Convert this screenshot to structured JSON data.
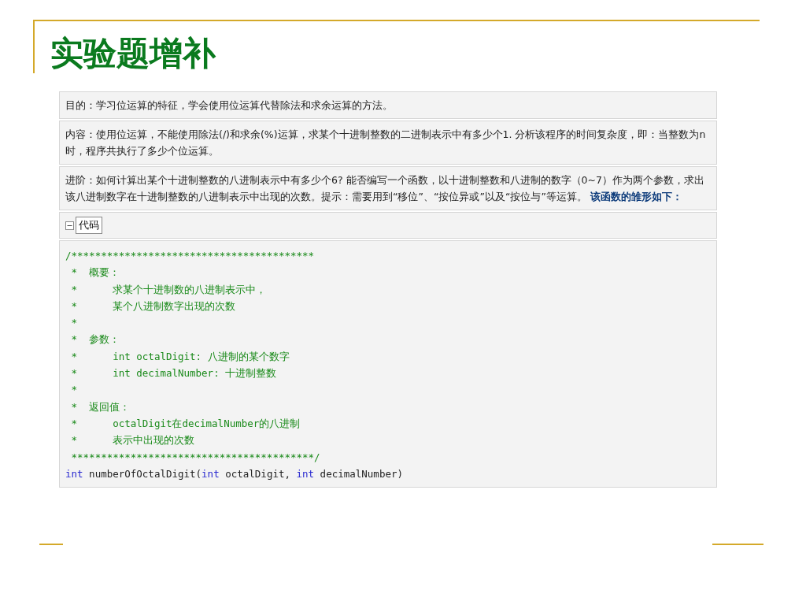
{
  "slide": {
    "title": "实验题增补"
  },
  "panels": [
    {
      "text": "目的：学习位运算的特征，学会使用位运算代替除法和求余运算的方法。"
    },
    {
      "text": "内容：使用位运算，不能使用除法(/)和求余(%)运算，求某个十进制整数的二进制表示中有多少个1. 分析该程序的时间复杂度，即：当整数为n时，程序共执行了多少个位运算。"
    },
    {
      "text": "进阶：如何计算出某个十进制整数的八进制表示中有多少个6? 能否编写一个函数，以十进制整数和八进制的数字（0~7）作为两个参数，求出该八进制数字在十进制整数的八进制表示中出现的次数。提示：需要用到“移位”、“按位异或”以及“按位与”等运算。 **该函数的雏形如下：**"
    }
  ],
  "code_block": {
    "toggle_label": "代码",
    "expanded": true,
    "lines": [
      {
        "kind": "comment",
        "text": "/*****************************************"
      },
      {
        "kind": "comment",
        "text": " *  概要："
      },
      {
        "kind": "comment",
        "text": " *      求某个十进制数的八进制表示中，"
      },
      {
        "kind": "comment",
        "text": " *      某个八进制数字出现的次数"
      },
      {
        "kind": "comment",
        "text": " *"
      },
      {
        "kind": "comment",
        "text": " *  参数："
      },
      {
        "kind": "comment",
        "text": " *      int octalDigit: 八进制的某个数字"
      },
      {
        "kind": "comment",
        "text": " *      int decimalNumber: 十进制整数"
      },
      {
        "kind": "comment",
        "text": " *"
      },
      {
        "kind": "comment",
        "text": " *  返回值："
      },
      {
        "kind": "comment",
        "text": " *      octalDigit在decimalNumber的八进制"
      },
      {
        "kind": "comment",
        "text": " *      表示中出现的次数"
      },
      {
        "kind": "comment",
        "text": " *****************************************/"
      },
      {
        "kind": "code",
        "tokens": [
          {
            "kind": "keyword",
            "text": "int"
          },
          {
            "kind": "plain",
            "text": " numberOfOctalDigit("
          },
          {
            "kind": "keyword",
            "text": "int"
          },
          {
            "kind": "plain",
            "text": " octalDigit, "
          },
          {
            "kind": "keyword",
            "text": "int"
          },
          {
            "kind": "plain",
            "text": " decimalNumber)"
          }
        ]
      }
    ]
  }
}
